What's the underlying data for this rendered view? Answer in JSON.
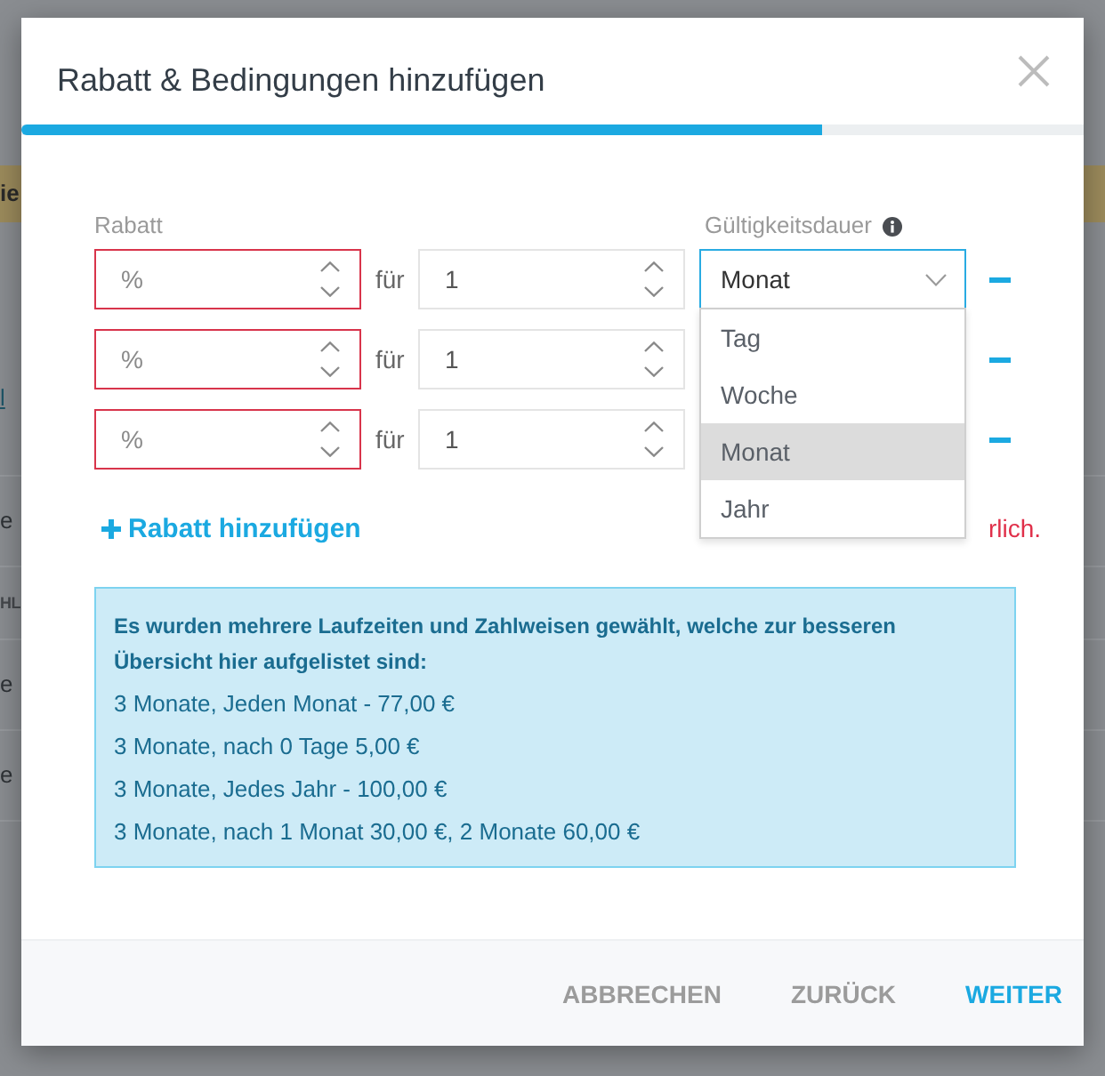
{
  "background": {
    "fragments": [
      {
        "text": "ie",
        "kind": "banner"
      },
      {
        "text": "l",
        "kind": "link"
      },
      {
        "text": "e",
        "kind": "cell"
      },
      {
        "text": "HL",
        "kind": "header"
      },
      {
        "text": "e",
        "kind": "cell"
      },
      {
        "text": "e",
        "kind": "cell"
      }
    ]
  },
  "dialog": {
    "title": "Rabatt & Bedingungen hinzufügen",
    "progress": {
      "level": 0.754
    },
    "form": {
      "labels": {
        "discount": "Rabatt",
        "validity": "Gültigkeitsdauer"
      },
      "rows": [
        {
          "discount": {
            "placeholder": "%",
            "invalid": true
          },
          "for_label": "für",
          "count": "1",
          "period": {
            "value": "Monat",
            "open": true,
            "options": [
              {
                "label": "Tag",
                "selected": false
              },
              {
                "label": "Woche",
                "selected": false
              },
              {
                "label": "Monat",
                "selected": true
              },
              {
                "label": "Jahr",
                "selected": false
              }
            ]
          }
        },
        {
          "discount": {
            "placeholder": "%",
            "invalid": true
          },
          "for_label": "für",
          "count": "1"
        },
        {
          "discount": {
            "placeholder": "%",
            "invalid": true
          },
          "for_label": "für",
          "count": "1"
        }
      ],
      "add_button": "Rabatt hinzufügen",
      "error_text": "rlich."
    },
    "info": {
      "heading": "Es wurden mehrere Laufzeiten und Zahlweisen gewählt, welche zur besseren Übersicht hier aufgelistet sind:",
      "items": [
        "3 Monate, Jeden Monat - 77,00 €",
        "3 Monate, nach 0 Tage 5,00 €",
        "3 Monate, Jedes Jahr - 100,00 €",
        "3 Monate, nach 1 Monat 30,00 €, 2 Monate 60,00 €"
      ]
    },
    "footer": {
      "buttons": [
        {
          "label": "ABBRECHEN",
          "primary": false
        },
        {
          "label": "ZURÜCK",
          "primary": false
        },
        {
          "label": "WEITER",
          "primary": true
        }
      ]
    }
  }
}
